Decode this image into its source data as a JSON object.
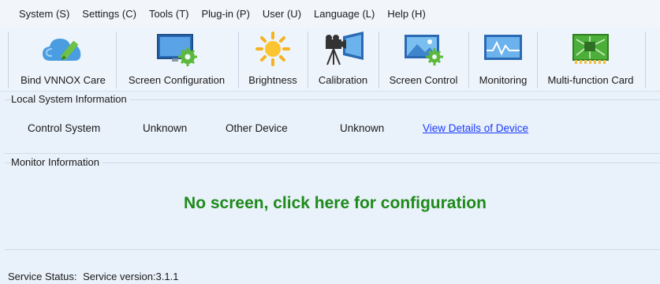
{
  "menu": [
    "System (S)",
    "Settings (C)",
    "Tools (T)",
    "Plug-in (P)",
    "User (U)",
    "Language (L)",
    "Help (H)"
  ],
  "toolbar": {
    "bind_care": "Bind VNNOX Care",
    "screen_config": "Screen Configuration",
    "brightness": "Brightness",
    "calibration": "Calibration",
    "screen_control": "Screen Control",
    "monitoring": "Monitoring",
    "multifunction_card": "Multi-function Card"
  },
  "icons": {
    "bind_care": "cloud-pen-icon",
    "screen_config": "monitor-gear-icon",
    "brightness": "sun-icon",
    "calibration": "camera-screen-icon",
    "screen_control": "picture-gear-icon",
    "monitoring": "waveform-monitor-icon",
    "multifunction_card": "circuit-board-icon"
  },
  "local_info": {
    "title": "Local System Information",
    "control_system_label": "Control System",
    "control_system_value": "Unknown",
    "other_device_label": "Other Device",
    "other_device_value": "Unknown",
    "view_details_link": "View Details of Device"
  },
  "monitor_info": {
    "title": "Monitor Information",
    "no_screen_message": "No screen, click here for configuration"
  },
  "status": {
    "service_status_label": "Service Status:",
    "service_version": "Service version:3.1.1"
  },
  "colors": {
    "link": "#1a3cff",
    "no_screen_message": "#1e8a1a",
    "background": "#e9f1fa"
  }
}
